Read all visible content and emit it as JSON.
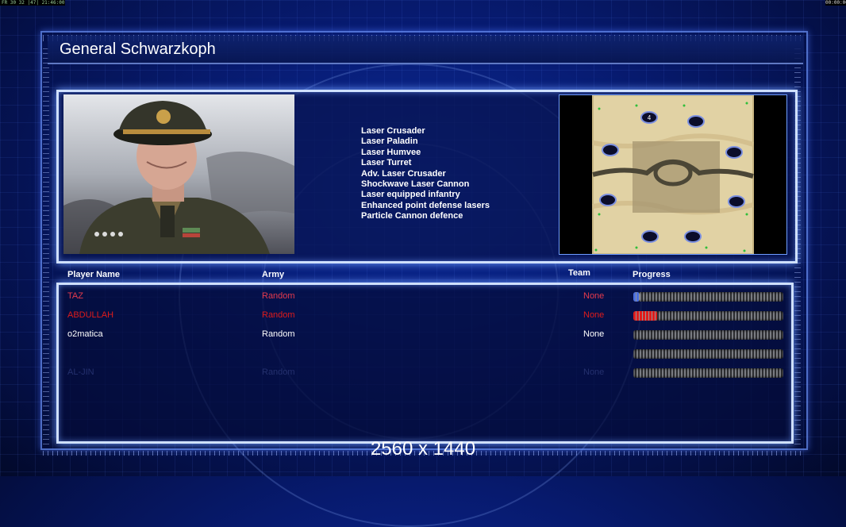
{
  "status": {
    "top_left": "FR 30 32 |47| 21:46:00",
    "top_right": "00:00:00"
  },
  "title": "General Schwarzkoph",
  "units": [
    "Laser Crusader",
    "Laser Paladin",
    "Laser Humvee",
    "Laser Turret",
    "Adv. Laser Crusader",
    "Shockwave Laser Cannon",
    "Laser equipped infantry",
    "Enhanced point defense lasers",
    "Particle Cannon defence"
  ],
  "minimap": {
    "start_label": "4"
  },
  "headers": {
    "player_name": "Player Name",
    "army": "Army",
    "team": "Team",
    "progress": "Progress"
  },
  "players": [
    {
      "name": "TAZ",
      "army": "Random",
      "team": "None",
      "progress": 0.04,
      "color": "#e63a4c",
      "fill_color": "#4a6fe0"
    },
    {
      "name": "ABDULLAH",
      "army": "Random",
      "team": "None",
      "progress": 0.16,
      "color": "#e01b1b",
      "fill_color": "#e01b1b"
    },
    {
      "name": "o2matica",
      "army": "Random",
      "team": "None",
      "progress": 0,
      "color": "#ffffff",
      "fill_color": "#ffffff"
    },
    {
      "name": "",
      "army": "",
      "team": "",
      "progress": 0,
      "color": "#3a4a8a",
      "fill_color": "#3a4a8a"
    },
    {
      "name": "AL-JIN",
      "army": "Random",
      "team": "None",
      "progress": 0,
      "color": "#24306e",
      "fill_color": "#24306e"
    }
  ],
  "resolution": "2560 x 1440",
  "colors": {
    "panel_border": "#cfe0ff",
    "glow": "#6f9dff",
    "background": "#071a6e"
  }
}
